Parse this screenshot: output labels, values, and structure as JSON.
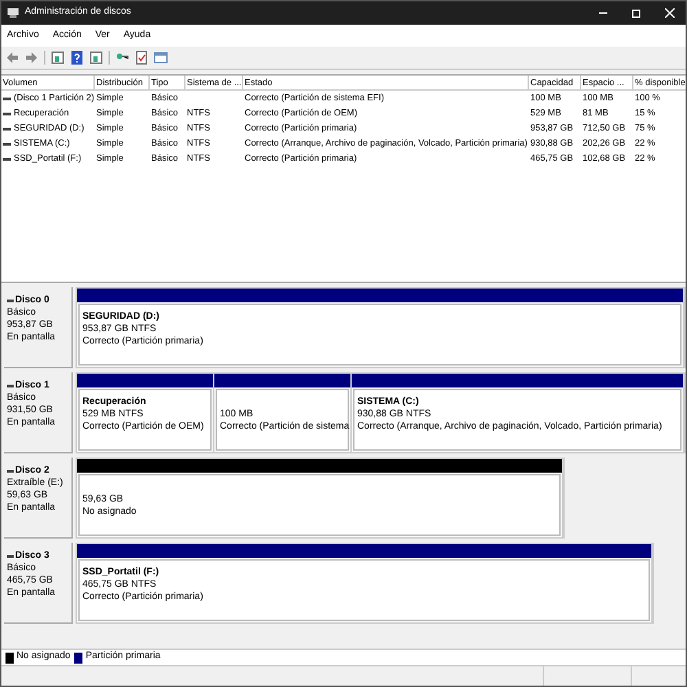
{
  "window": {
    "title": "Administración de discos"
  },
  "menu": [
    "Archivo",
    "Acción",
    "Ver",
    "Ayuda"
  ],
  "table": {
    "columns": [
      "Volumen",
      "Distribución",
      "Tipo",
      "Sistema de ...",
      "Estado",
      "Capacidad",
      "Espacio ...",
      "% disponible"
    ],
    "rows": [
      [
        "(Disco 1 Partición 2)",
        "Simple",
        "Básico",
        "",
        "Correcto (Partición de sistema EFI)",
        "100 MB",
        "100 MB",
        "100 %"
      ],
      [
        "Recuperación",
        "Simple",
        "Básico",
        "NTFS",
        "Correcto (Partición de OEM)",
        "529 MB",
        "81 MB",
        "15 %"
      ],
      [
        "SEGURIDAD (D:)",
        "Simple",
        "Básico",
        "NTFS",
        "Correcto (Partición primaria)",
        "953,87 GB",
        "712,50 GB",
        "75 %"
      ],
      [
        "SISTEMA (C:)",
        "Simple",
        "Básico",
        "NTFS",
        "Correcto (Arranque, Archivo de paginación, Volcado, Partición primaria)",
        "930,88 GB",
        "202,26 GB",
        "22 %"
      ],
      [
        "SSD_Portatil (F:)",
        "Simple",
        "Básico",
        "NTFS",
        "Correcto (Partición primaria)",
        "465,75 GB",
        "102,68 GB",
        "22 %"
      ]
    ]
  },
  "disks": [
    {
      "name": "Disco 0",
      "type": "Básico",
      "size": "953,87 GB",
      "status": "En pantalla",
      "partitions": [
        {
          "kind": "primary",
          "name": "SEGURIDAD  (D:)",
          "size": "953,87 GB NTFS",
          "status": "Correcto (Partición primaria)"
        }
      ]
    },
    {
      "name": "Disco 1",
      "type": "Básico",
      "size": "931,50 GB",
      "status": "En pantalla",
      "partitions": [
        {
          "kind": "primary",
          "name": "Recuperación",
          "size": "529 MB NTFS",
          "status": "Correcto (Partición de OEM)"
        },
        {
          "kind": "primary",
          "size": "100 MB",
          "status": "Correcto (Partición de sistema"
        },
        {
          "kind": "primary",
          "name": "SISTEMA  (C:)",
          "size": "930,88 GB NTFS",
          "status": "Correcto (Arranque, Archivo de paginación, Volcado, Partición primaria)"
        }
      ]
    },
    {
      "name": "Disco 2",
      "type": "Extraíble (E:)",
      "size": "59,63 GB",
      "status": "En pantalla",
      "partitions": [
        {
          "kind": "unallocated",
          "size": "59,63 GB",
          "status": "No asignado"
        }
      ]
    },
    {
      "name": "Disco 3",
      "type": "Básico",
      "size": "465,75 GB",
      "status": "En pantalla",
      "partitions": [
        {
          "kind": "primary",
          "name": "SSD_Portatil  (F:)",
          "size": "465,75 GB NTFS",
          "status": "Correcto (Partición primaria)"
        }
      ]
    }
  ],
  "legend": [
    {
      "label": "No asignado",
      "color": "#000000"
    },
    {
      "label": "Partición primaria",
      "color": "#00007f"
    }
  ]
}
